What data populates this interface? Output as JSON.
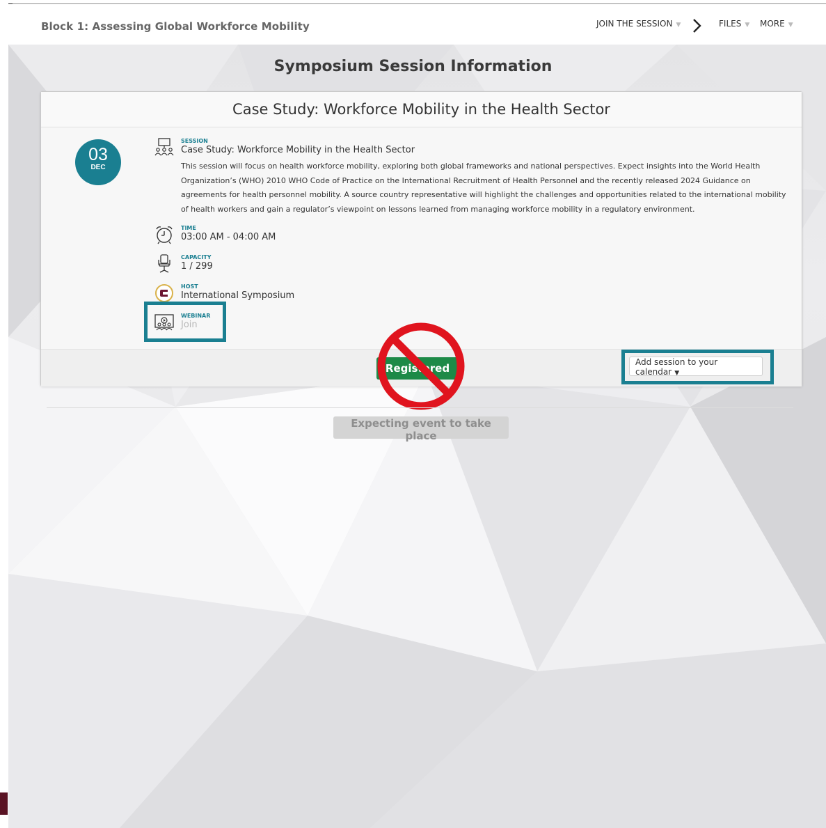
{
  "header": {
    "block_title": "Block 1: Assessing Global Workforce Mobility",
    "nav": {
      "join_session": "JOIN THE SESSION",
      "files": "FILES",
      "more": "MORE",
      "dropdown_glyph": "▼",
      "arrow_icon": "chevron-right-icon"
    }
  },
  "page": {
    "heading": "Symposium Session Information"
  },
  "session": {
    "title": "Case Study: Workforce Mobility in the Health Sector",
    "date": {
      "day": "03",
      "month": "DEC"
    },
    "session_label": "SESSION",
    "session_name": "Case Study: Workforce Mobility in the Health Sector",
    "description": "This session will focus on health workforce mobility, exploring both global frameworks and national perspectives. Expect insights into the World Health Organization’s (WHO) 2010 WHO Code of Practice on the International Recruitment of Health Personnel and the recently released 2024 Guidance on agreements for health personnel mobility. A source country representative will highlight the challenges and opportunities related to the international mobility of health workers and gain a regulator’s viewpoint on lessons learned from managing workforce mobility in a regulatory environment.",
    "time_label": "TIME",
    "time_value": "03:00 AM - 04:00 AM",
    "capacity_label": "CAPACITY",
    "capacity_value": "1 / 299",
    "host_label": "HOST",
    "host_value": "International Symposium",
    "webinar_label": "WEBINAR",
    "webinar_value": "Join"
  },
  "footer": {
    "registered_label": "Registered",
    "calendar_label": "Add session to your calendar",
    "calendar_caret": "▼"
  },
  "status": {
    "expecting_label": "Expecting event to take place"
  },
  "colors": {
    "accent_teal": "#1a7f91",
    "registered_green": "#1d8a47",
    "prohibit_red": "#e0141e",
    "host_logo_maroon": "#6b1530"
  },
  "icons": {
    "session": "presentation-audience-icon",
    "time": "alarm-clock-icon",
    "capacity": "office-chair-icon",
    "host": "host-logo-icon",
    "webinar": "webinar-screen-icon",
    "overlay": "prohibited-sign-icon"
  }
}
